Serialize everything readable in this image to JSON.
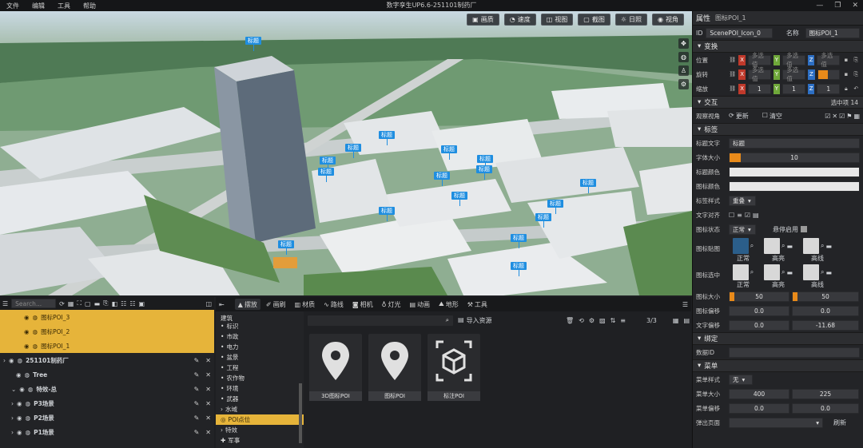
{
  "menu": [
    "文件",
    "编辑",
    "工具",
    "帮助"
  ],
  "app_title": "数字孪生UP6.6-251101制药厂",
  "viewport": {
    "buttons": [
      {
        "icon": "image-icon",
        "label": "画质"
      },
      {
        "icon": "speed-icon",
        "label": "速度"
      },
      {
        "icon": "view-icon",
        "label": "视图"
      },
      {
        "icon": "screenshot-icon",
        "label": "截图"
      },
      {
        "icon": "sun-icon",
        "label": "日照"
      },
      {
        "icon": "eye-icon",
        "label": "视角"
      }
    ],
    "poi_label": "标题"
  },
  "props": {
    "header": "属性",
    "object_name": "图标POI_1",
    "id_label": "ID",
    "id_value": "ScenePOI_Icon_0",
    "name_label": "名称",
    "name_value": "图标POI_1",
    "transform": {
      "title": "变换",
      "position": "位置",
      "rotation": "旋转",
      "scale": "缩放",
      "multi": "多选值",
      "axes": [
        "X",
        "Y",
        "Z"
      ],
      "scale_values": [
        "1",
        "1",
        "1"
      ]
    },
    "interaction": {
      "title": "交互",
      "selected": "选中项 14",
      "view_angle": "观察视角",
      "update": "更新",
      "clear": "清空"
    },
    "label": {
      "title": "标签",
      "text_label": "标题文字",
      "text_value": "标题",
      "font_size_label": "字体大小",
      "font_size_value": "10",
      "label_color": "标题颜色",
      "icon_color": "图标颜色",
      "style_label": "标签样式",
      "style_value": "重叠",
      "align_label": "文字对齐",
      "icon_state_label": "图标状态",
      "icon_state_value": "正常",
      "hover_label": "悬停启用",
      "icon_map_label": "图标贴图",
      "icon_selected_label": "图标选中",
      "normal": "正常",
      "highlight": "高亮",
      "high": "高线",
      "icon_size_label": "图标大小",
      "icon_size": [
        "50",
        "50"
      ],
      "icon_offset_label": "图标偏移",
      "icon_offset": [
        "0.0",
        "0.0"
      ],
      "text_offset_label": "文字偏移",
      "text_offset": [
        "0.0",
        "-11.68"
      ]
    },
    "binding": {
      "title": "绑定",
      "data_id": "数据ID"
    },
    "menu_sect": {
      "title": "菜单",
      "style_label": "菜单样式",
      "style_value": "无",
      "size_label": "菜单大小",
      "size": [
        "400",
        "225"
      ],
      "offset_label": "菜单偏移",
      "offset": [
        "0.0",
        "0.0"
      ],
      "popup_label": "弹出页面",
      "refresh": "刷新"
    }
  },
  "tree": {
    "search_placeholder": "Search...",
    "rows": [
      {
        "label": "图标POI_3",
        "sel": true,
        "indent": 2
      },
      {
        "label": "图标POI_2",
        "sel": true,
        "indent": 2
      },
      {
        "label": "图标POI_1",
        "sel": true,
        "indent": 2
      },
      {
        "label": "251101制药厂",
        "sel": false,
        "indent": 0
      },
      {
        "label": "Tree",
        "sel": false,
        "indent": 1
      },
      {
        "label": "特效-总",
        "sel": false,
        "indent": 1
      },
      {
        "label": "P3场景",
        "sel": false,
        "indent": 1
      },
      {
        "label": "P2场景",
        "sel": false,
        "indent": 1
      },
      {
        "label": "P1场景",
        "sel": false,
        "indent": 1
      }
    ]
  },
  "assets": {
    "tabs": [
      "摆放",
      "画刷",
      "材质",
      "路线",
      "相机",
      "灯光",
      "动画",
      "地形",
      "工具"
    ],
    "categories": [
      "建筑",
      "标识",
      "市政",
      "电力",
      "盆景",
      "工程",
      "农作物",
      "环境",
      "武器",
      "水域",
      "POI点位",
      "特效",
      "军事"
    ],
    "import_label": "导入资源",
    "page": "3/3",
    "items": [
      {
        "label": "3D图标POI",
        "icon": "pin-icon"
      },
      {
        "label": "图标POI",
        "icon": "pin-icon"
      },
      {
        "label": "标注POI",
        "icon": "cube-icon"
      }
    ]
  },
  "colors": {
    "accent": "#e88a1a",
    "selection": "#e6b43a",
    "poi": "#1f8ee0"
  }
}
